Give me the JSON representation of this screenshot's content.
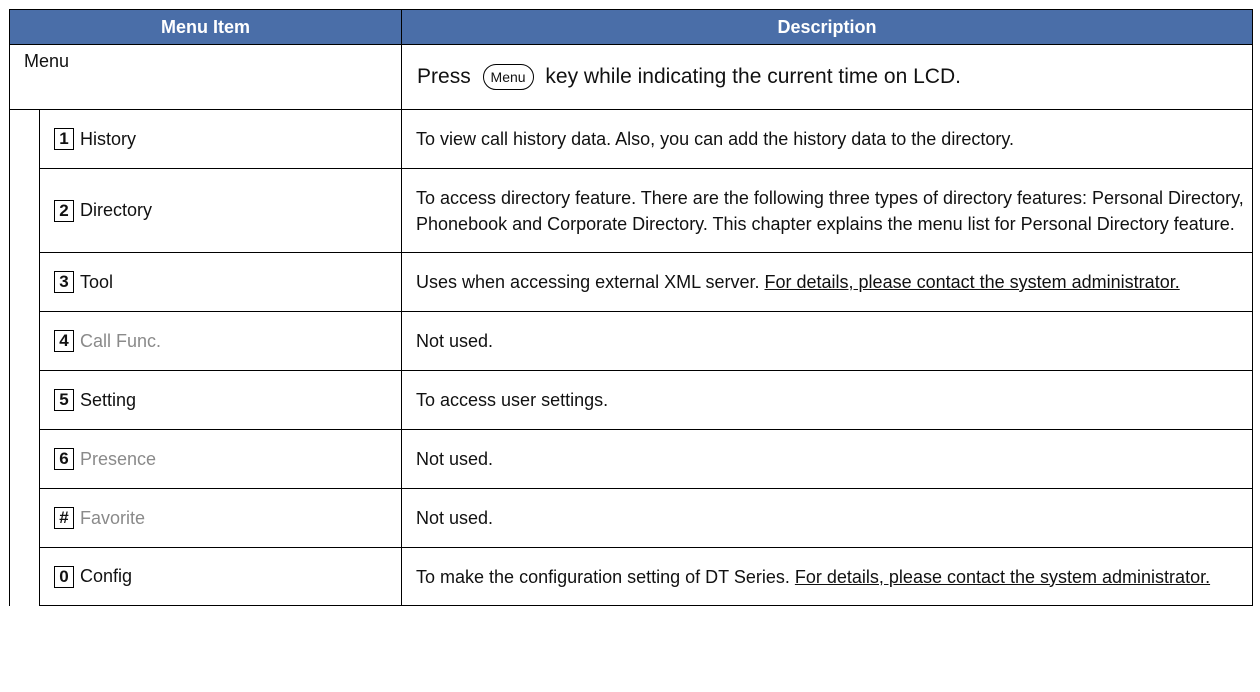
{
  "header": {
    "menu_item": "Menu Item",
    "description": "Description"
  },
  "menu_row": {
    "label": "Menu",
    "desc_before": "Press",
    "key_label": "Menu",
    "desc_after": "key while indicating the current time on LCD."
  },
  "items": [
    {
      "key": "1",
      "label": "History",
      "used": true,
      "desc": "To view call history data. Also, you can add the history data to the directory.",
      "link": ""
    },
    {
      "key": "2",
      "label": "Directory",
      "used": true,
      "desc": "To access directory feature. There are the following three types of directory features: Personal Directory, Phonebook and Corporate Directory. This chapter explains the menu list for Personal Directory feature.",
      "link": ""
    },
    {
      "key": "3",
      "label": "Tool",
      "used": true,
      "desc": "Uses when accessing external XML server. ",
      "link": "For details, please contact the system administrator."
    },
    {
      "key": "4",
      "label": "Call Func.",
      "used": false,
      "desc": "Not used.",
      "link": ""
    },
    {
      "key": "5",
      "label": "Setting",
      "used": true,
      "desc": "To access user settings.",
      "link": ""
    },
    {
      "key": "6",
      "label": "Presence",
      "used": false,
      "desc": "Not used.",
      "link": ""
    },
    {
      "key": "#",
      "label": "Favorite",
      "used": false,
      "desc": "Not used.",
      "link": ""
    },
    {
      "key": "0",
      "label": "Config",
      "used": true,
      "desc": "To make the configuration setting of DT Series. ",
      "link": "For details, please contact the system administrator."
    }
  ],
  "colors": {
    "header_bg": "#4a6ea8",
    "header_text": "#ffffff",
    "disabled_text": "#8a8a8a"
  }
}
